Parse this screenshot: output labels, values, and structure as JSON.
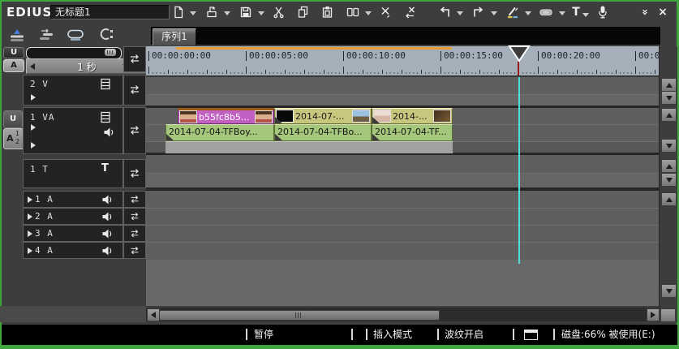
{
  "app": {
    "logo": "EDIUS",
    "project_title": "无标题1"
  },
  "toolbar": {
    "icons": [
      "new-sequence",
      "open-project",
      "save-project",
      "cut",
      "copy",
      "paste",
      "add-between",
      "delete",
      "ripple-delete",
      "undo",
      "redo",
      "add-cut-point",
      "set-transition",
      "create-title",
      "voice-over",
      "more",
      "close"
    ],
    "title_glyph": "T",
    "more_glyph": "»",
    "close_glyph": "×"
  },
  "mode_bar": {
    "icons": [
      "overwrite-mode",
      "sync-lock-mode",
      "loop-mode",
      "snap-mode"
    ]
  },
  "sequence_tab": {
    "label": "序列1"
  },
  "panel": {
    "mute_video": "U",
    "mute_audio": "A",
    "scale": {
      "value": "1 秒"
    },
    "channel": {
      "letter": "A",
      "top": "1",
      "bottom": "2"
    }
  },
  "tracks": {
    "v2": {
      "label": "2 V"
    },
    "va1": {
      "label": "1 VA"
    },
    "t1": {
      "label": "1 T",
      "icon_label": "T"
    },
    "a1": {
      "label": "1 A"
    },
    "a2": {
      "label": "2 A"
    },
    "a3": {
      "label": "3 A"
    },
    "a4": {
      "label": "4 A"
    }
  },
  "ruler": {
    "labels": [
      "00:00:00:00",
      "00:00:05:00",
      "00:00:10:00",
      "00:00:15:00",
      "00:00:20:00",
      "00:00"
    ]
  },
  "clips": {
    "video": [
      {
        "label": "b55fc8b5...",
        "thumb_left": "boy-face-photo",
        "thumb_right": "boy-face-photo",
        "color": "#c25fc2"
      },
      {
        "label": "2014-07-...",
        "thumb_left": "black-frame",
        "thumb_right": "landscape-frame",
        "color": "#c8c77d"
      },
      {
        "label": "2014-...",
        "thumb_left": "baby-face-frame",
        "thumb_right": "dark-frame",
        "color": "#c8c77d"
      }
    ],
    "audio": [
      {
        "label": "2014-07-04-TFBoy...",
        "color": "#a5c77c"
      },
      {
        "label": "2014-07-04-TFBo...",
        "color": "#a5c77c"
      },
      {
        "label": "2014-07-04-TF...",
        "color": "#a5c77c"
      }
    ]
  },
  "status": {
    "playback": "暂停",
    "mode": "插入模式",
    "ripple": "波纹开启",
    "disk": "磁盘:66% 被使用(E:)"
  },
  "colors": {
    "window_border_green": "#3fa63f",
    "ruler_bg": "#a5afba",
    "range_orange": "#e89c32",
    "playhead_red": "#991c1c",
    "playhead_cyan": "#52dcd6",
    "clip_purple": "#c25fc2",
    "clip_olive": "#c8c77d",
    "clip_audio_green": "#a5c77c"
  }
}
